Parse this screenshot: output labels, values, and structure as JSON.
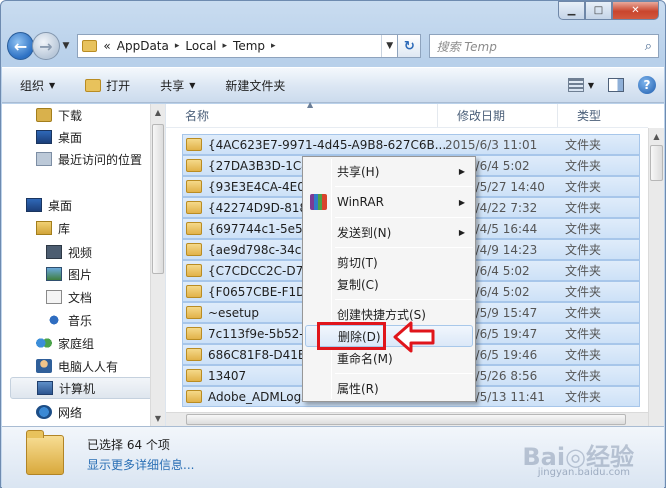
{
  "address": {
    "breadcrumb_prefix": "«",
    "crumbs": [
      "AppData",
      "Local",
      "Temp"
    ]
  },
  "search": {
    "placeholder": "搜索 Temp"
  },
  "toolbar": {
    "organize": "组织",
    "open": "打开",
    "share": "共享",
    "new_folder": "新建文件夹"
  },
  "nav": {
    "items": [
      {
        "label": "下载",
        "icon": "download-folder-icon"
      },
      {
        "label": "桌面",
        "icon": "desktop-icon"
      },
      {
        "label": "最近访问的位置",
        "icon": "recent-places-icon"
      },
      {
        "label": "桌面",
        "icon": "desktop-icon"
      },
      {
        "label": "库",
        "icon": "library-icon"
      },
      {
        "label": "视频",
        "icon": "video-icon"
      },
      {
        "label": "图片",
        "icon": "picture-icon"
      },
      {
        "label": "文档",
        "icon": "document-icon"
      },
      {
        "label": "音乐",
        "icon": "music-icon"
      },
      {
        "label": "家庭组",
        "icon": "homegroup-icon"
      },
      {
        "label": "电脑人人有",
        "icon": "user-icon"
      },
      {
        "label": "计算机",
        "icon": "computer-icon"
      },
      {
        "label": "网络",
        "icon": "network-icon"
      }
    ]
  },
  "columns": {
    "name": "名称",
    "date": "修改日期",
    "type": "类型"
  },
  "files": [
    {
      "name": "{4AC623E7-9971-4d45-A9B8-627C6B...",
      "date": "2015/6/3 11:01",
      "type": "文件夹"
    },
    {
      "name": "{27DA3B3D-1C43",
      "date": "2015/6/4 5:02",
      "type": "文件夹"
    },
    {
      "name": "{93E3E4CA-4E07",
      "date": "2015/5/27 14:40",
      "type": "文件夹"
    },
    {
      "name": "{42274D9D-8180",
      "date": "2015/4/22 7:32",
      "type": "文件夹"
    },
    {
      "name": "{697744c1-5e5f-",
      "date": "2015/4/5 16:44",
      "type": "文件夹"
    },
    {
      "name": "{ae9d798c-34c9-",
      "date": "2015/4/9 14:23",
      "type": "文件夹"
    },
    {
      "name": "{C7CDCC2C-D70",
      "date": "2015/6/4 5:02",
      "type": "文件夹"
    },
    {
      "name": "{F0657CBE-F1DD",
      "date": "2015/6/4 5:02",
      "type": "文件夹"
    },
    {
      "name": "~esetup",
      "date": "2015/5/9 15:47",
      "type": "文件夹"
    },
    {
      "name": "7c113f9e-5b52-4",
      "date": "2015/6/5 19:47",
      "type": "文件夹"
    },
    {
      "name": "686C81F8-D41E-",
      "date": "2015/6/5 19:46",
      "type": "文件夹"
    },
    {
      "name": "13407",
      "date": "2015/5/26 8:56",
      "type": "文件夹"
    },
    {
      "name": "Adobe_ADMLogs",
      "date": "2015/5/13 11:41",
      "type": "文件夹"
    }
  ],
  "context_menu": {
    "share": "共享(H)",
    "winrar": "WinRAR",
    "send_to": "发送到(N)",
    "cut": "剪切(T)",
    "copy": "复制(C)",
    "create_shortcut": "创建快捷方式(S)",
    "delete": "删除(D)",
    "rename": "重命名(M)",
    "properties": "属性(R)"
  },
  "status": {
    "selected": "已选择 64 个项",
    "more_details": "显示更多详细信息..."
  },
  "watermark": {
    "text": "Bai◎经验",
    "sub": "jingyan.baidu.com"
  },
  "colors": {
    "highlight_box": "#e0151b",
    "selection": "#cde1f7"
  }
}
